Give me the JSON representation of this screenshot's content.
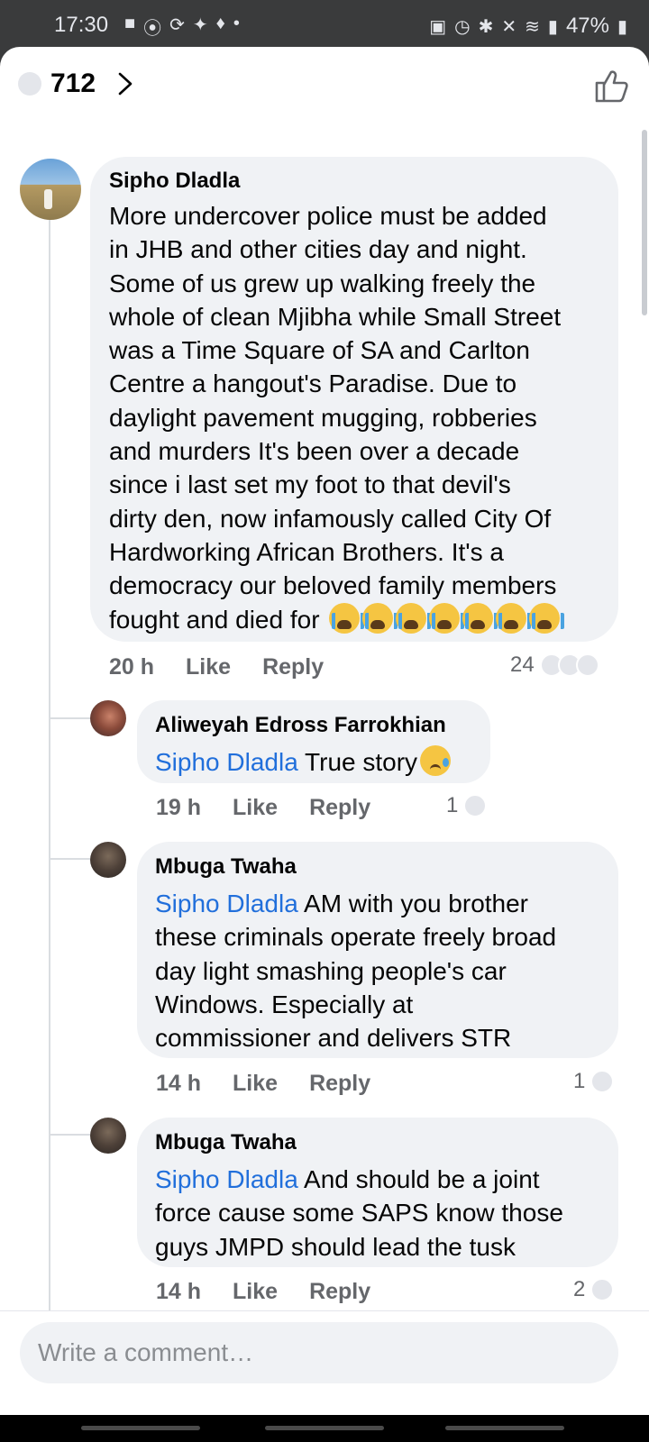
{
  "status_bar": {
    "time": "17:30",
    "battery": "47%",
    "left_icons": [
      "message-icon",
      "facebook-icon",
      "sync-icon",
      "twitter-icon",
      "app-icon",
      "dot-icon"
    ],
    "right_icons": [
      "lock-icon",
      "alarm-icon",
      "bluetooth-icon",
      "mute-icon",
      "wifi-icon",
      "signal-icon",
      "battery-icon"
    ]
  },
  "header": {
    "reaction_count": "712"
  },
  "comments": [
    {
      "author": "Sipho Dladla",
      "lines": [
        "More undercover police must be added",
        "in JHB and other cities day and night.",
        "Some of us grew up walking freely the",
        "whole of clean Mjibha while Small Street",
        "was a Time Square of SA and Carlton",
        "Centre a hangout's Paradise. Due to",
        "daylight  pavement mugging, robberies",
        "and murders   It's been over a decade",
        "since i last set my foot to that devil's",
        "dirty den, now infamously called City Of",
        "Hardworking African Brothers. It's a",
        "democracy our beloved family members",
        "fought and died for"
      ],
      "emoji_count": 7,
      "time": "20 h",
      "like": "Like",
      "reply": "Reply",
      "reactions": "24"
    }
  ],
  "replies": [
    {
      "author": "Aliweyah Edross Farrokhian",
      "mention": "Sipho Dladla",
      "lines": [
        " True story"
      ],
      "time": "19 h",
      "like": "Like",
      "reply": "Reply",
      "reactions": "1"
    },
    {
      "author": "Mbuga Twaha",
      "mention": "Sipho Dladla",
      "lines": [
        " AM with you brother",
        "these criminals operate  freely broad",
        "day light smashing  people's car",
        "Windows. Especially at",
        "commissioner and delivers STR"
      ],
      "time": "14 h",
      "like": "Like",
      "reply": "Reply",
      "reactions": "1"
    },
    {
      "author": "Mbuga Twaha",
      "mention": "Sipho Dladla",
      "lines": [
        " And should be a joint",
        "force cause some SAPS know those",
        "guys JMPD should lead the tusk"
      ],
      "time": "14 h",
      "like": "Like",
      "reply": "Reply",
      "reactions": "2"
    }
  ],
  "composer": {
    "placeholder": "Write a comment…"
  },
  "colors": {
    "mention": "#216fdb",
    "bubble": "#f0f2f5",
    "meta": "#65676b"
  }
}
